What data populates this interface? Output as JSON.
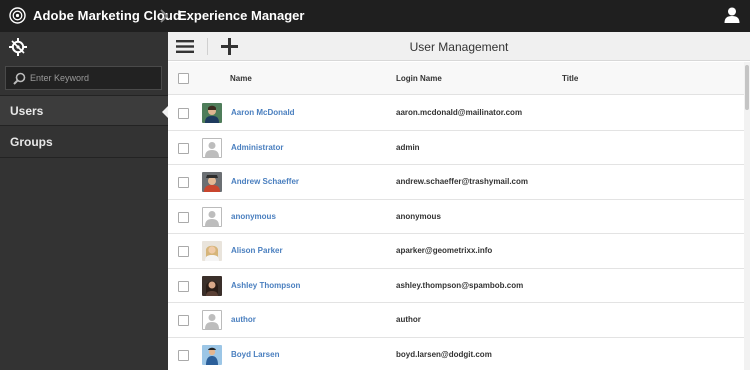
{
  "header": {
    "app_title": "Adobe Marketing Cloud",
    "product_title": "Experience Manager",
    "logo_icon": "adobe-marketing-cloud-logo",
    "user_icon": "user-icon"
  },
  "sidebar": {
    "rail_icon": "navigation-compass-icon",
    "search": {
      "placeholder": "Enter Keyword",
      "value": ""
    },
    "items": [
      {
        "label": "Users",
        "active": true
      },
      {
        "label": "Groups",
        "active": false
      }
    ]
  },
  "main": {
    "title": "User Management",
    "toolbar": {
      "menu_icon": "hamburger-menu-icon",
      "add_icon": "add-icon"
    },
    "columns": [
      "Name",
      "Login Name",
      "Title"
    ],
    "users": [
      {
        "name": "Aaron McDonald",
        "login": "aaron.mcdonald@mailinator.com",
        "title": "",
        "avatar": "photo"
      },
      {
        "name": "Administrator",
        "login": "admin",
        "title": "",
        "avatar": "placeholder"
      },
      {
        "name": "Andrew Schaeffer",
        "login": "andrew.schaeffer@trashymail.com",
        "title": "",
        "avatar": "photo"
      },
      {
        "name": "anonymous",
        "login": "anonymous",
        "title": "",
        "avatar": "placeholder"
      },
      {
        "name": "Alison Parker",
        "login": "aparker@geometrixx.info",
        "title": "",
        "avatar": "photo"
      },
      {
        "name": "Ashley Thompson",
        "login": "ashley.thompson@spambob.com",
        "title": "",
        "avatar": "photo"
      },
      {
        "name": "author",
        "login": "author",
        "title": "",
        "avatar": "placeholder"
      },
      {
        "name": "Boyd Larsen",
        "login": "boyd.larsen@dodgit.com",
        "title": "",
        "avatar": "photo"
      }
    ]
  },
  "colors": {
    "topbar": "#1f1f1f",
    "sidebar": "#333333",
    "link": "#4a7fbf"
  }
}
